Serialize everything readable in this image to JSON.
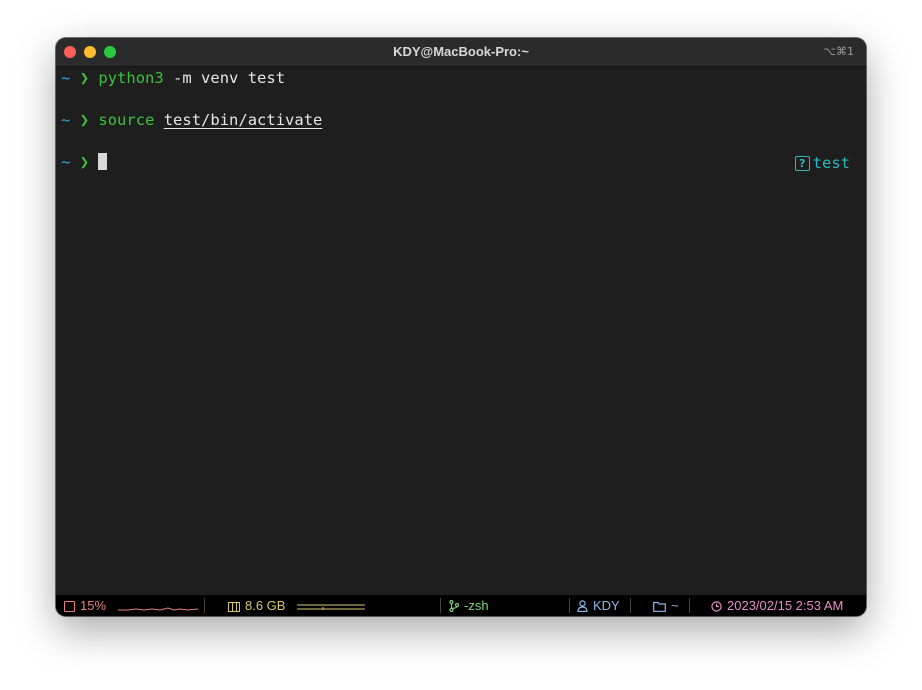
{
  "window": {
    "title": "KDY@MacBook-Pro:~",
    "shortcut": "⌥⌘1"
  },
  "terminal": {
    "prompt_tilde": "~",
    "prompt_chevron": "❯",
    "lines": [
      {
        "command": "python3",
        "args": "-m venv test"
      },
      {
        "command": "source",
        "args": "test/bin/activate"
      },
      {
        "command": "",
        "args": ""
      }
    ],
    "venv_indicator": "test"
  },
  "status_bar": {
    "cpu": {
      "value": "15%",
      "color": "#e8827c",
      "icon": "cpu-chip-icon"
    },
    "memory": {
      "value": "8.6 GB",
      "color": "#d6c86a",
      "icon": "memory-chip-icon"
    },
    "process": {
      "value": "-zsh",
      "color": "#7fd17f",
      "icon": "git-branch-icon"
    },
    "user": {
      "value": "KDY",
      "color": "#8fb7e8",
      "icon": "person-icon"
    },
    "directory": {
      "value": "~",
      "color": "#8fb7e8",
      "icon": "folder-icon"
    },
    "clock": {
      "value": "2023/02/15 2:53 AM",
      "color": "#e88fc8",
      "icon": "clock-icon"
    }
  }
}
